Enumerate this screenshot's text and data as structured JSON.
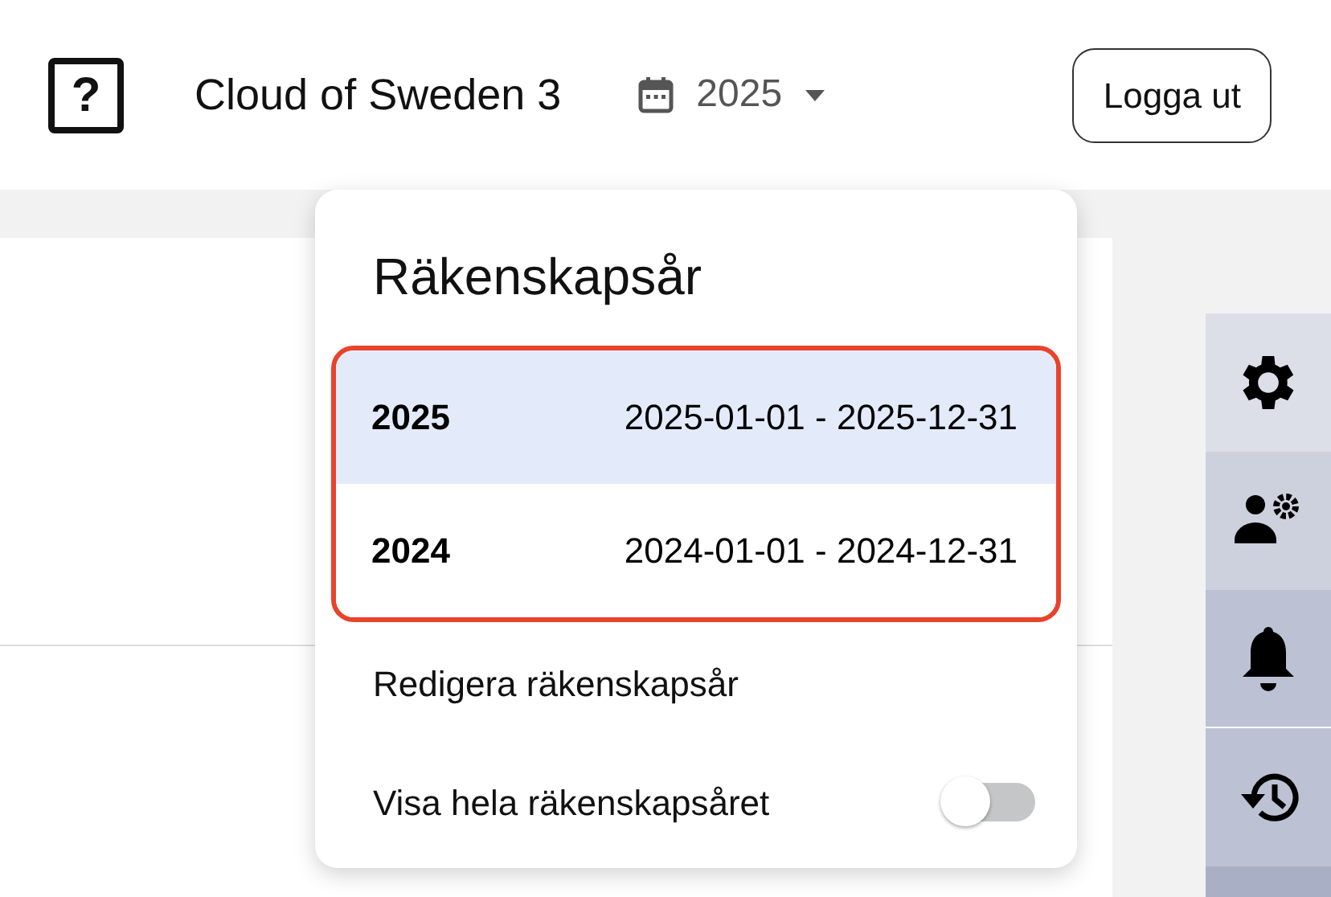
{
  "header": {
    "logo_glyph": "?",
    "title": "Cloud of Sweden 3",
    "year_picker": {
      "value": "2025"
    },
    "logout_button": "Logga ut"
  },
  "fiscal_year_menu": {
    "title": "Räkenskapsår",
    "years": [
      {
        "year": "2025",
        "range": "2025-01-01 - 2025-12-31",
        "selected": true
      },
      {
        "year": "2024",
        "range": "2024-01-01 - 2024-12-31",
        "selected": false
      }
    ],
    "edit_link": "Redigera räkenskapsår",
    "toggle": {
      "label": "Visa hela räkenskapsåret",
      "on": false
    }
  },
  "sidebar": {
    "items": [
      {
        "kind": "settings"
      },
      {
        "kind": "user-settings"
      },
      {
        "kind": "notifications"
      },
      {
        "kind": "history"
      }
    ]
  }
}
